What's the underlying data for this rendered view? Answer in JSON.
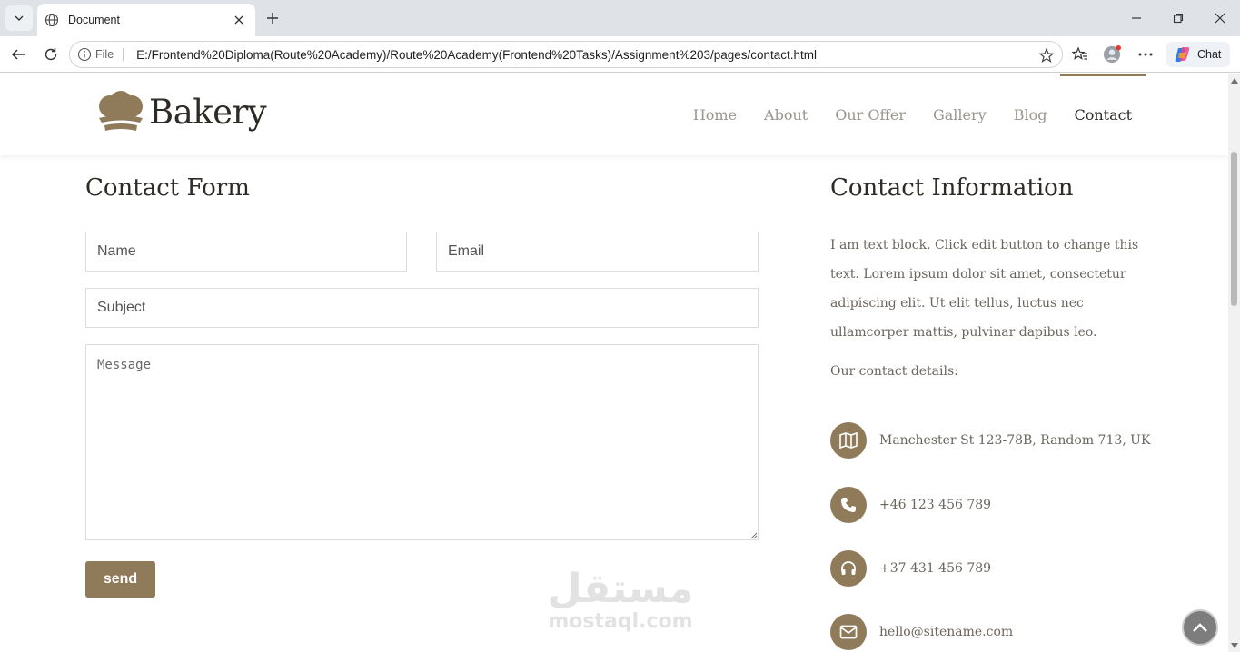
{
  "browser": {
    "tab_title": "Document",
    "address_prefix": "File",
    "url": "E:/Frontend%20Diploma(Route%20Academy)/Route%20Academy(Frontend%20Tasks)/Assignment%203/pages/contact.html",
    "chat_label": "Chat"
  },
  "site": {
    "brand": "Bakery",
    "nav": [
      "Home",
      "About",
      "Our Offer",
      "Gallery",
      "Blog",
      "Contact"
    ],
    "active_nav": "Contact",
    "accent_color": "#8f7a5a"
  },
  "form": {
    "heading": "Contact Form",
    "name_placeholder": "Name",
    "email_placeholder": "Email",
    "subject_placeholder": "Subject",
    "message_placeholder": "Message",
    "send_label": "send"
  },
  "info": {
    "heading": "Contact Information",
    "text": "I am text block. Click edit button to change this text. Lorem ipsum dolor sit amet, consectetur adipiscing elit. Ut elit tellus, luctus nec ullamcorper mattis, pulvinar dapibus leo.",
    "details_label": "Our contact details:",
    "items": [
      {
        "icon": "map-icon",
        "text": "Manchester St 123-78B, Random 713, UK"
      },
      {
        "icon": "phone-icon",
        "text": "+46 123 456 789"
      },
      {
        "icon": "headphones-icon",
        "text": "+37 431 456 789"
      },
      {
        "icon": "envelope-icon",
        "text": "hello@sitename.com"
      }
    ]
  },
  "watermark": {
    "arabic": "مستقل",
    "latin": "mostaql.com"
  }
}
